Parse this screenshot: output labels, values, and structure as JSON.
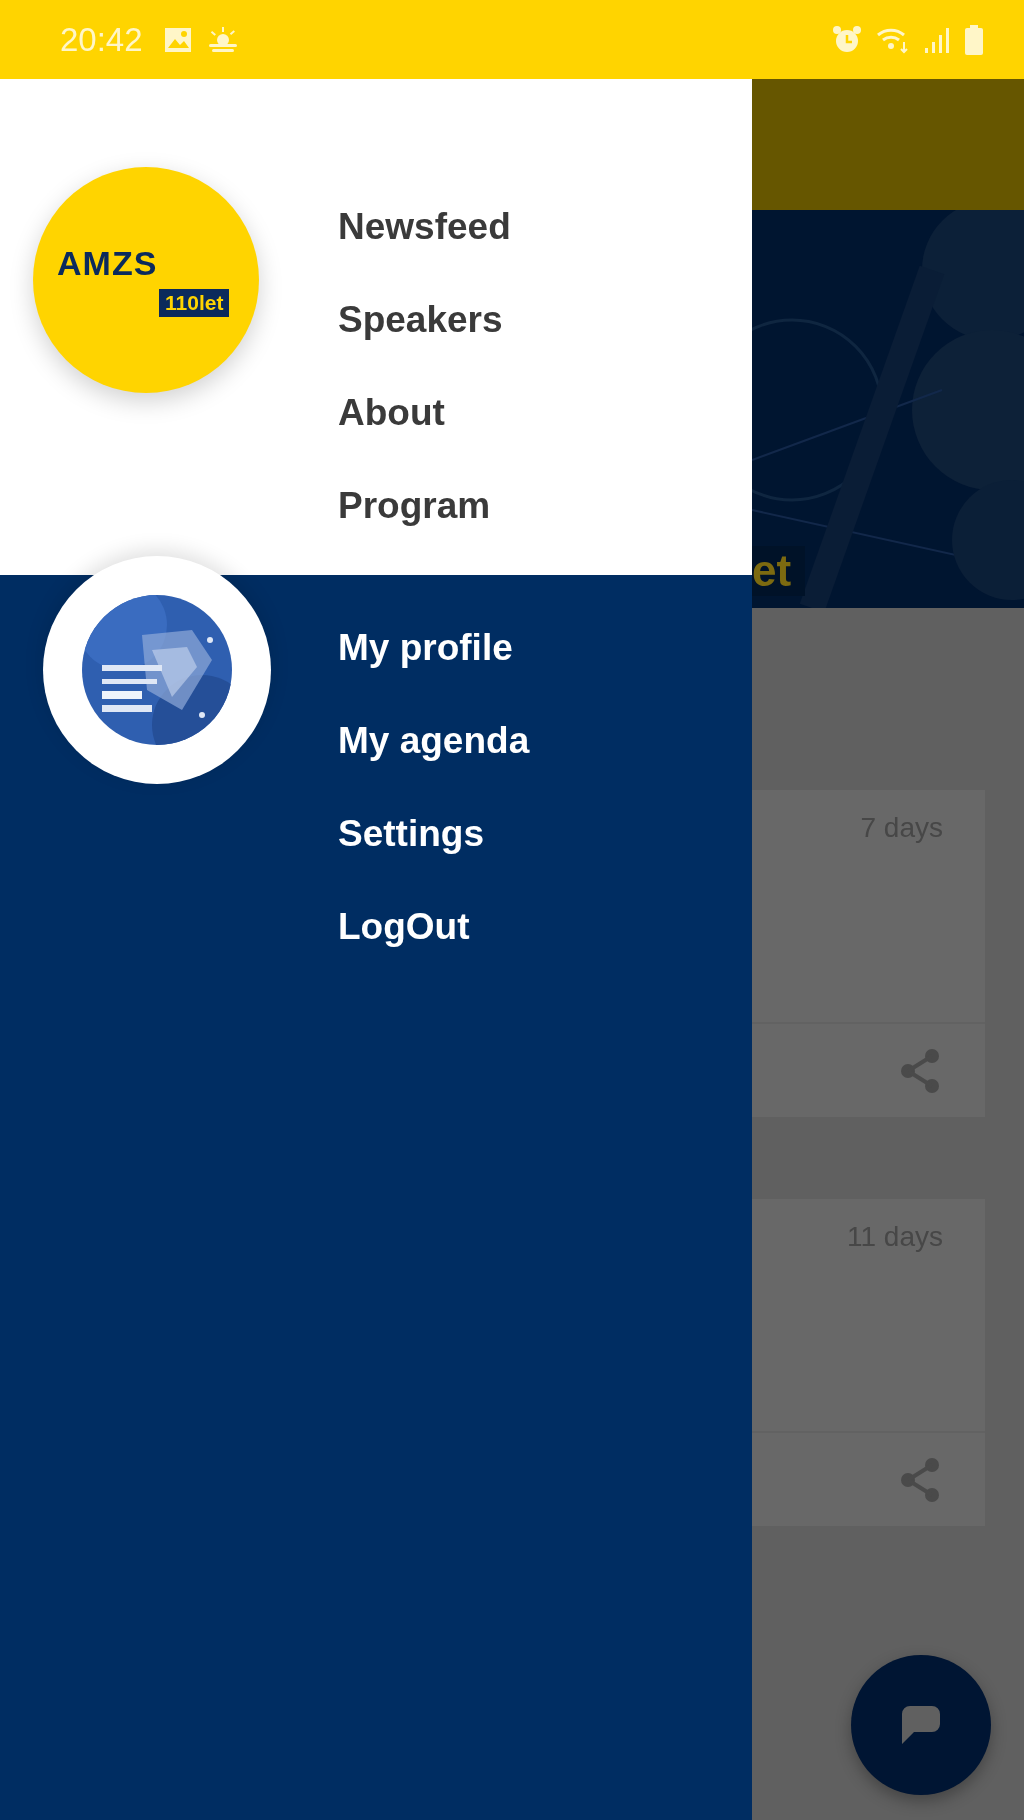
{
  "status_bar": {
    "time": "20:42"
  },
  "drawer": {
    "logo": {
      "title": "AMZS",
      "badge": "110let"
    },
    "main_menu": [
      {
        "label": "Newsfeed"
      },
      {
        "label": "Speakers"
      },
      {
        "label": "About"
      },
      {
        "label": "Program"
      }
    ],
    "user_menu": [
      {
        "label": "My profile"
      },
      {
        "label": "My agenda"
      },
      {
        "label": "Settings"
      },
      {
        "label": "LogOut"
      }
    ]
  },
  "background": {
    "banner_text": "et",
    "cards": [
      {
        "age": "7 days"
      },
      {
        "age": "11 days"
      }
    ]
  }
}
